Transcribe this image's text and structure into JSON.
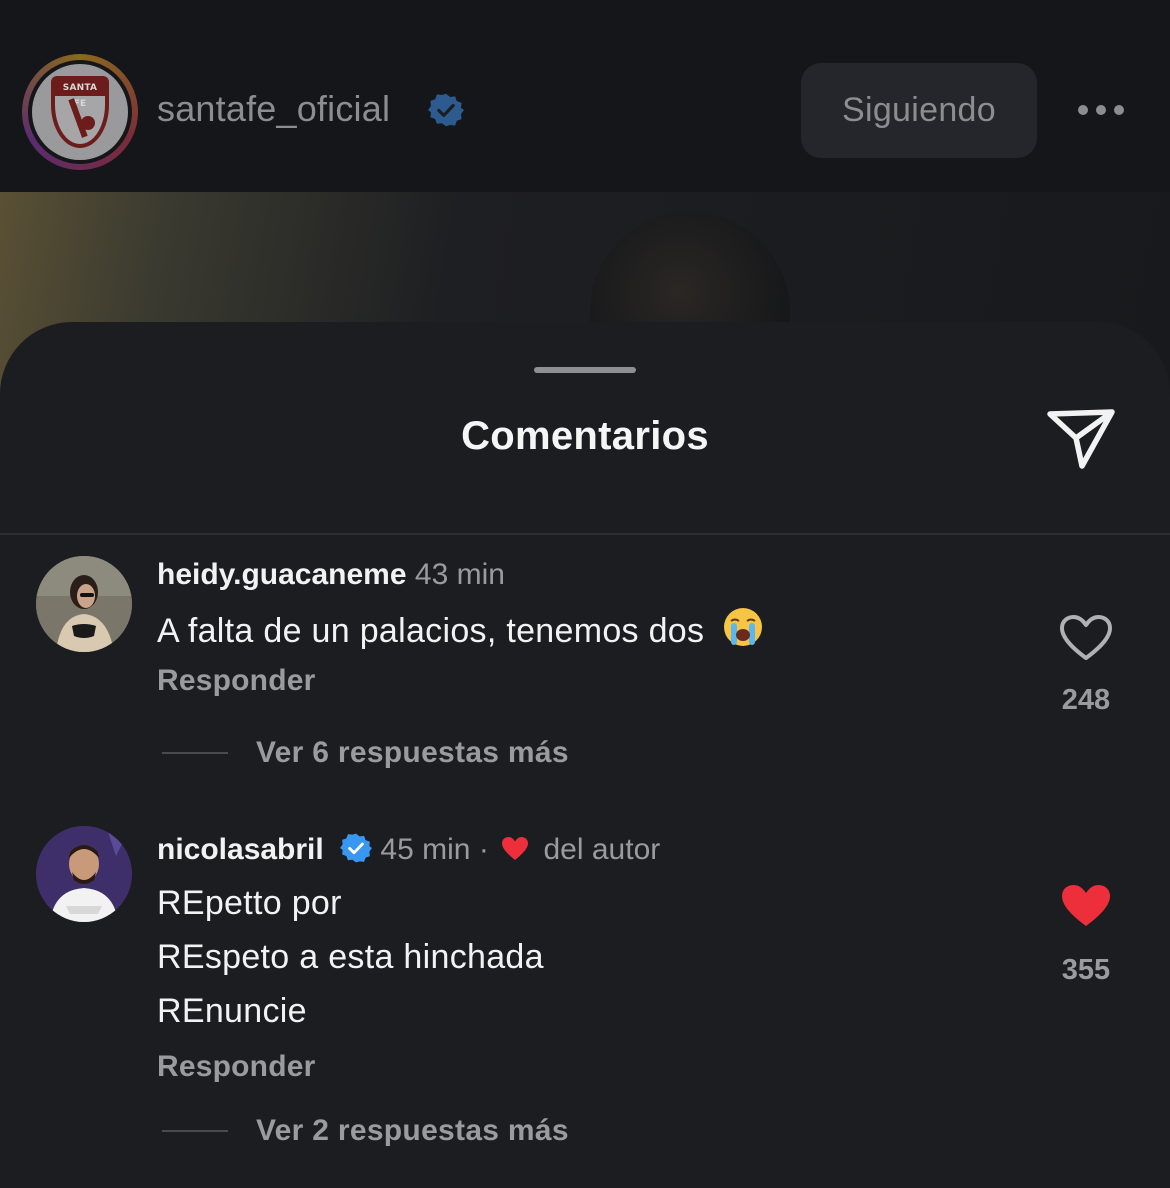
{
  "header": {
    "username": "santafe_oficial",
    "follow_label": "Siguiendo",
    "avatar_crest_text": "SANTA FE"
  },
  "sheet": {
    "title": "Comentarios"
  },
  "comments": [
    {
      "username": "heidy.guacaneme",
      "time": "43 min",
      "verified": false,
      "lines": [
        "A falta de un palacios, tenemos dos"
      ],
      "emoji": "loudly-crying-face",
      "reply_label": "Responder",
      "view_replies_label": "Ver 6 respuestas más",
      "likes": "248",
      "liked": false
    },
    {
      "username": "nicolasabril",
      "time": "45 min",
      "separator": "·",
      "author_like_label": "del autor",
      "verified": true,
      "lines": [
        "REpetto por",
        "REspeto a esta hinchada",
        "REnuncie"
      ],
      "reply_label": "Responder",
      "view_replies_label": "Ver 2 respuestas más",
      "likes": "355",
      "liked": true
    }
  ],
  "colors": {
    "verified": "#3897f0",
    "like_red": "#ed2f3c",
    "sheet_bg": "#1b1d21",
    "secondary_text": "#9a9b9f"
  }
}
